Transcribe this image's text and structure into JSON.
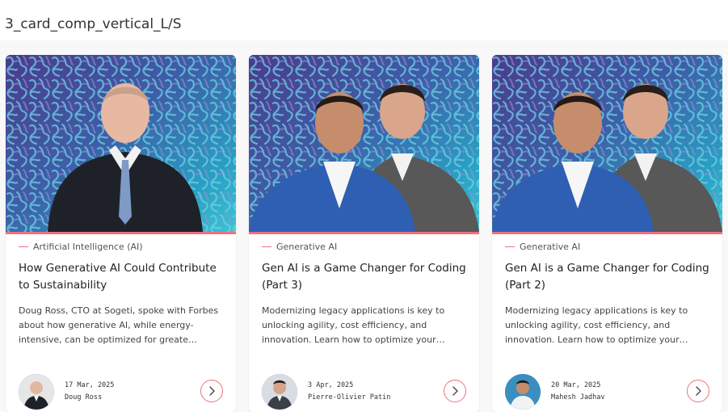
{
  "page": {
    "title": "3_card_comp_vertical_L/S"
  },
  "colors": {
    "accent": "#f0707e",
    "hero_gradient_start": "#4b3a8c",
    "hero_gradient_end": "#3fc3d3"
  },
  "cards": [
    {
      "category": "Artificial Intelligence (AI)",
      "title": "How Generative AI Could Contribute to Sustainability",
      "excerpt": "Doug Ross, CTO at Sogeti, spoke with Forbes about how generative AI, while energy-intensive, can be optimized for greate…",
      "date": "17 Mar, 2025",
      "author": "Doug Ross",
      "icon": "chevron-right-icon"
    },
    {
      "category": "Generative AI",
      "title": "Gen AI is a Game Changer for Coding (Part 3)",
      "excerpt": "Modernizing legacy applications is key to unlocking agility, cost efficiency, and innovation. Learn how to optimize your…",
      "date": "3 Apr, 2025",
      "author": "Pierre-Olivier Patin",
      "icon": "chevron-right-icon"
    },
    {
      "category": "Generative AI",
      "title": "Gen AI is a Game Changer for Coding (Part 2)",
      "excerpt": "Modernizing legacy applications is key to unlocking agility, cost efficiency, and innovation. Learn how to optimize your…",
      "date": "20 Mar, 2025",
      "author": "Mahesh Jadhav",
      "icon": "chevron-right-icon"
    }
  ]
}
